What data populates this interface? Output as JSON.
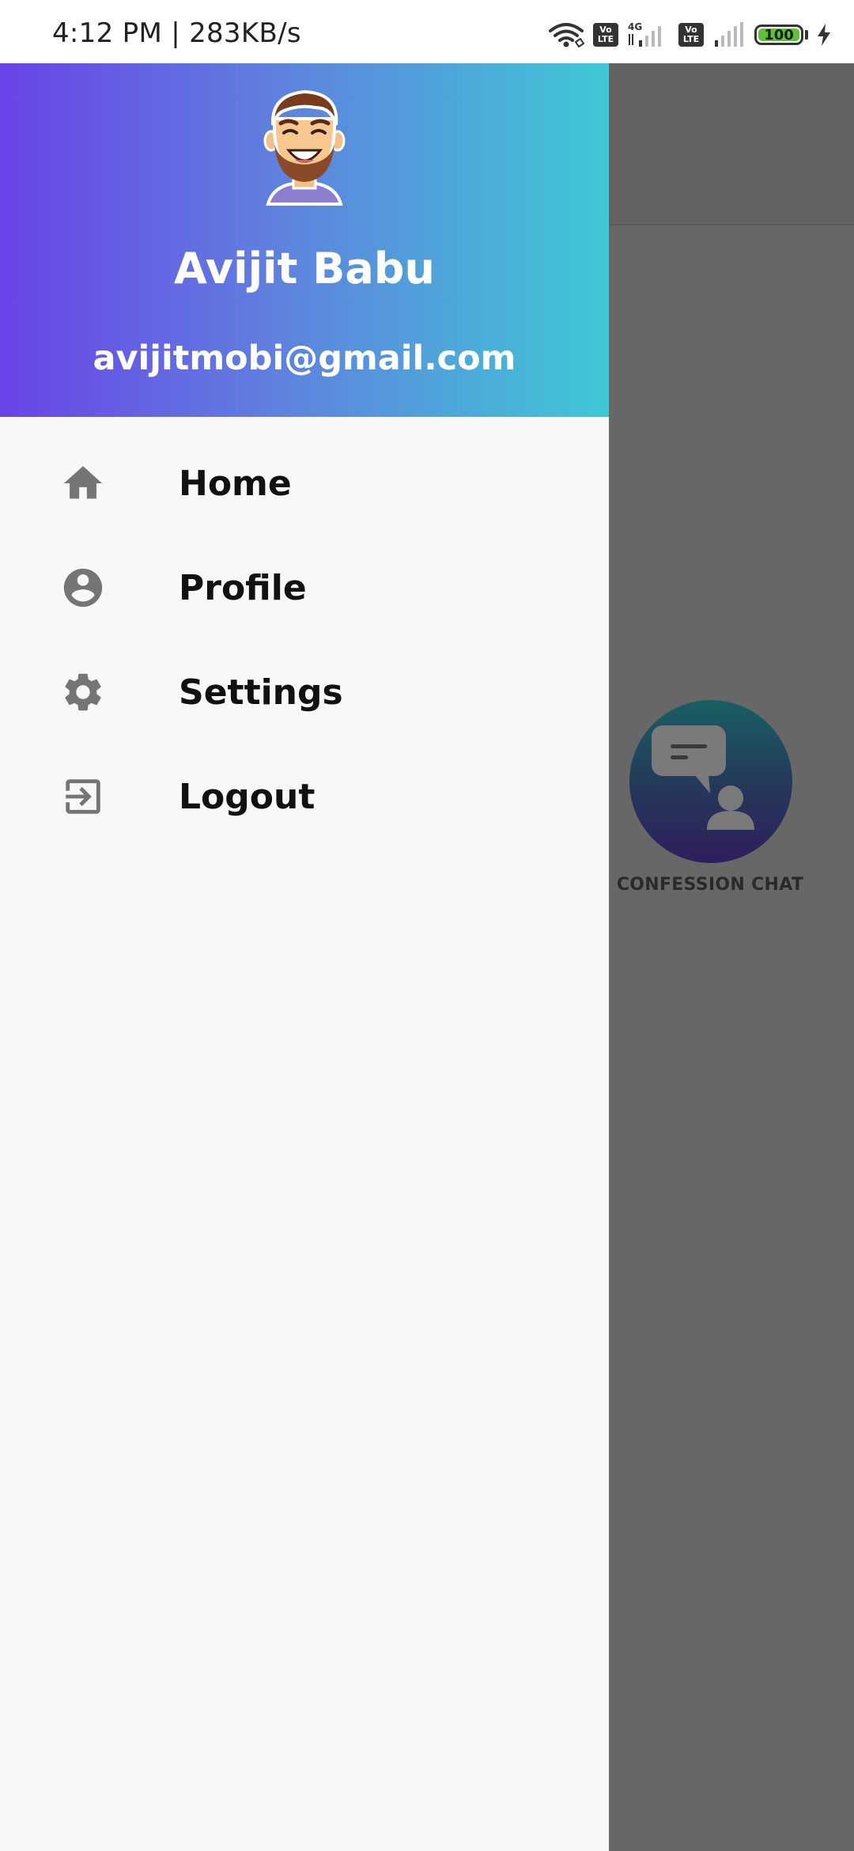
{
  "status_bar": {
    "time": "4:12 PM | 283KB/s",
    "sim1_label": "Vo LTE",
    "network_type": "4G",
    "sim2_label": "Vo LTE",
    "battery_level": "100",
    "battery_color": "#5fc234"
  },
  "drawer": {
    "header": {
      "user_name": "Avijit Babu",
      "user_email": "avijitmobi@gmail.com",
      "gradient_colors": [
        "#6a43e8",
        "#5f80de",
        "#3fc8d6"
      ]
    },
    "items": [
      {
        "label": "Home",
        "icon": "home-icon"
      },
      {
        "label": "Profile",
        "icon": "account-circle-icon"
      },
      {
        "label": "Settings",
        "icon": "gear-icon"
      },
      {
        "label": "Logout",
        "icon": "logout-icon"
      }
    ]
  },
  "background_app": {
    "feature_label": "CONFESSION CHAT",
    "feature_icon": "chat-person-icon"
  }
}
